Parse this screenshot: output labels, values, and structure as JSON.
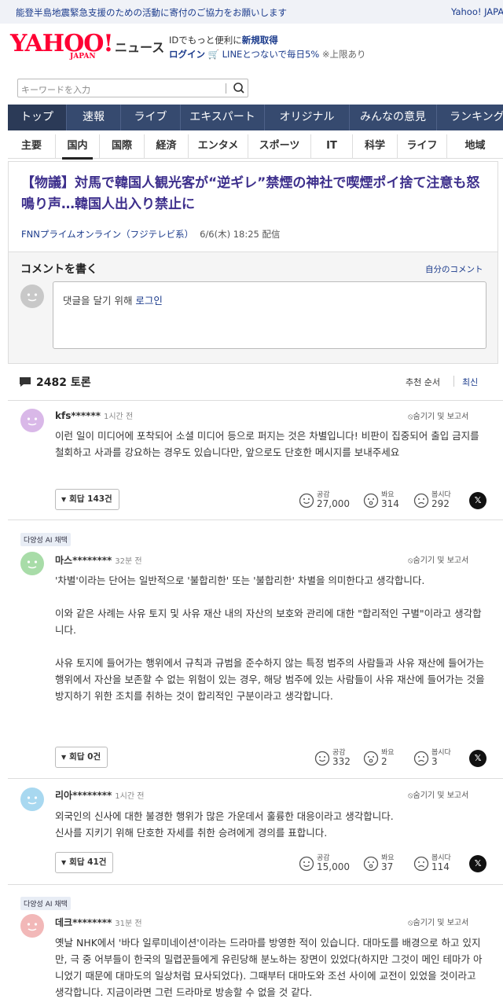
{
  "topbar": {
    "notice": "能登半島地震緊急支援のための活動に寄付のご協力をお願いします",
    "brand": "Yahoo! JAPAN"
  },
  "header": {
    "logo_main": "YAHOO!",
    "logo_sub": "JAPAN",
    "section": "ニュース",
    "promo1_prefix": "IDでもっと便利に",
    "promo1_link": "新規取得",
    "login": "ログイン",
    "promo2": "LINEとつないで毎日5%",
    "promo2_note": "※上限あり"
  },
  "search": {
    "placeholder": "キーワードを入力"
  },
  "nav": {
    "items": [
      "トップ",
      "速報",
      "ライブ",
      "エキスパート",
      "オリジナル",
      "みんなの意見",
      "ランキング"
    ]
  },
  "subnav": {
    "items": [
      "主要",
      "国内",
      "国際",
      "経済",
      "エンタメ",
      "スポーツ",
      "IT",
      "科学",
      "ライフ",
      "地域"
    ]
  },
  "article": {
    "title": "【物議】対馬で韓国人観光客が“逆ギレ”禁煙の神社で喫煙ポイ捨て注意も怒鳴り声…韓国人出入り禁止に",
    "source": "FNNプライムオンライン（フジテレビ系）",
    "date": "6/6(木) 18:25 配信"
  },
  "comment_form": {
    "title": "コメントを書く",
    "my_comments": "自分のコメント",
    "prompt": "댓글을 달기 위해 ",
    "login_link": "로그인"
  },
  "discussion": {
    "count_label": "2482 토론",
    "sort_recommended": "추천 순서",
    "sort_latest": "최신"
  },
  "comments": [
    {
      "badge": "",
      "user": "kfs******",
      "time": "1시간 전",
      "hide_report": "숨기기 및 보고서",
      "body": "이런 일이 미디어에 포착되어 소셜 미디어 등으로 퍼지는 것은 차별입니다! 비판이 집중되어 출입 금지를 철회하고 사과를 강요하는 경우도 있습니다만, 앞으로도 단호한 메시지를 보내주세요",
      "replies": "회답 143건",
      "agree_label": "공감",
      "agree": "27,000",
      "seen_label": "봐요",
      "seen": "314",
      "ugh_label": "봅시다",
      "ugh": "292",
      "avatar_color": "#d9b8e8"
    },
    {
      "badge": "다양성 AI 채택",
      "user": "마스********",
      "time": "32분 전",
      "hide_report": "숨기기 및 보고서",
      "body": "'차별'이라는 단어는 일반적으로 '불합리한' 또는 '불합리한' 차별을 의미한다고 생각합니다.\n\n이와 같은 사례는 사유 토지 및 사유 재산 내의 자산의 보호와 관리에 대한 \"합리적인 구별\"이라고 생각합니다.\n\n사유 토지에 들어가는 행위에서 규칙과 규범을 준수하지 않는 특정 범주의 사람들과 사유 재산에 들어가는 행위에서 자산을 보존할 수 없는 위험이 있는 경우, 해당 범주에 있는 사람들이 사유 재산에 들어가는 것을 방지하기 위한 조치를 취하는 것이 합리적인 구분이라고 생각합니다.",
      "replies": "회답 0건",
      "agree_label": "공감",
      "agree": "332",
      "seen_label": "봐요",
      "seen": "2",
      "ugh_label": "봅시다",
      "ugh": "3",
      "avatar_color": "#a8dca8"
    },
    {
      "badge": "",
      "user": "리아********",
      "time": "1시간 전",
      "hide_report": "숨기기 및 보고서",
      "body": "외국인의 신사에 대한 불경한 행위가 많은 가운데서 훌륭한 대응이라고 생각합니다.\n신사를 지키기 위해 단호한 자세를 취한 승려에게 경의를 표합니다.",
      "replies": "회답 41건",
      "agree_label": "공감",
      "agree": "15,000",
      "seen_label": "봐요",
      "seen": "37",
      "ugh_label": "봅시다",
      "ugh": "114",
      "avatar_color": "#a8d8f0"
    },
    {
      "badge": "다양성 AI 채택",
      "user": "데크********",
      "time": "31분 전",
      "hide_report": "숨기기 및 보고서",
      "body": "옛날 NHK에서 '바다 일루미네이션'이라는 드라마를 방영한 적이 있습니다. 대마도를 배경으로 하고 있지만, 극 중 어부들이 한국의 밀렵꾼들에게 유린당해 분노하는 장면이 있었다(하지만 그것이 메인 테마가 아니었기 때문에 대마도의 일상처럼 묘사되었다). 그때부터 대마도와 조선 사이에 교전이 있었을 것이라고 생각합니다. 지금이라면 그런 드라마로 방송할 수 없을 것 같다.",
      "avatar_color": "#f2b8b8"
    }
  ],
  "colors": {
    "nav_bg": "#364a6f",
    "title_purple": "#3d2f8c",
    "link_blue": "#1b3b8c",
    "yahoo_red": "#ff0033"
  }
}
